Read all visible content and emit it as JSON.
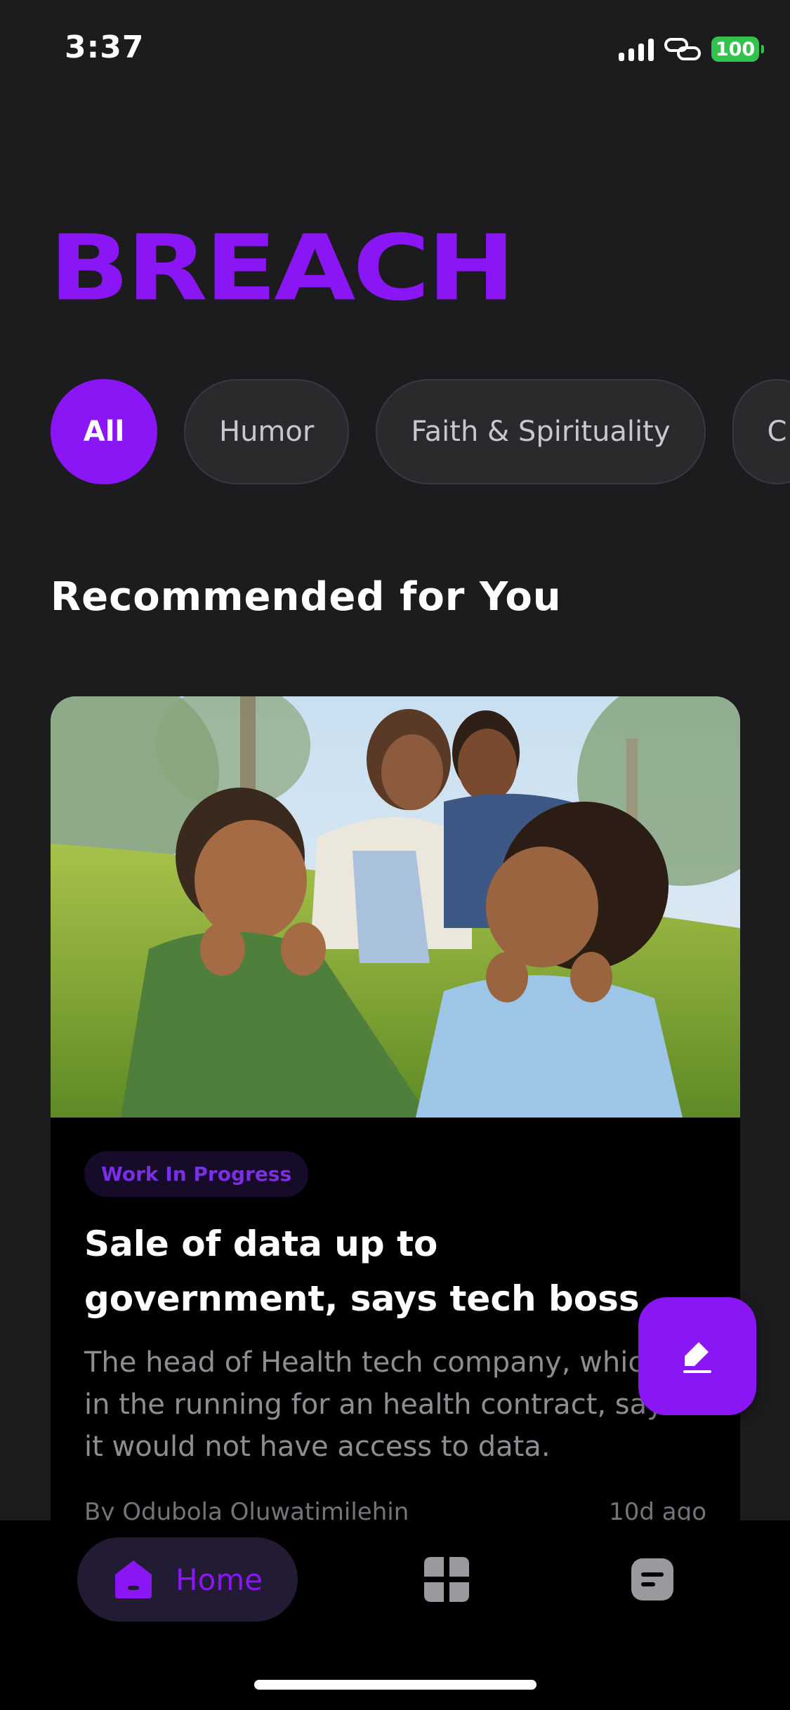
{
  "status_bar": {
    "time": "3:37",
    "battery": "100",
    "signal_icon": "cellular-signal-icon",
    "link_icon": "personal-hotspot-icon"
  },
  "header": {
    "logo": "BREACH"
  },
  "categories": [
    {
      "label": "All",
      "active": true
    },
    {
      "label": "Humor",
      "active": false
    },
    {
      "label": "Faith & Spirituality",
      "active": false
    },
    {
      "label": "C",
      "active": false
    }
  ],
  "section": {
    "title": "Recommended for You"
  },
  "article": {
    "tag": "Work In Progress",
    "title": "Sale of data up to government, says tech boss",
    "description": "The head of Health tech company, which is in the running for an health contract, says it would not have access to data.",
    "author": "By Odubola Oluwatimilehin",
    "age": "10d ago"
  },
  "fab": {
    "icon": "edit-pen-icon"
  },
  "bottom_nav": {
    "items": [
      {
        "label": "Home",
        "icon": "home-icon",
        "active": true
      },
      {
        "label": "",
        "icon": "grid-icon",
        "active": false
      },
      {
        "label": "",
        "icon": "message-icon",
        "active": false
      }
    ]
  },
  "colors": {
    "accent": "#8a16f5",
    "background": "#1c1b1e",
    "card": "#000000",
    "battery": "#33c24d"
  }
}
